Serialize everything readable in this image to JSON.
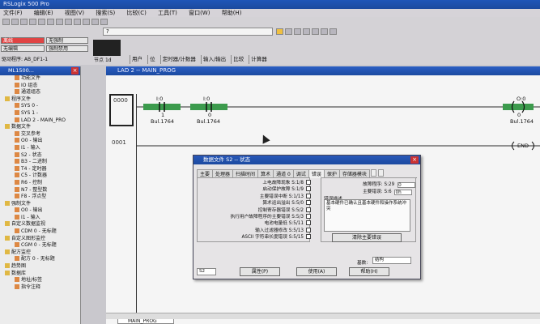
{
  "app": {
    "title": "RSLogix 500 Pro"
  },
  "menu": [
    "文件(F)",
    "编辑(E)",
    "视图(V)",
    "搜索(S)",
    "比较(C)",
    "工具(T)",
    "窗口(W)",
    "帮助(H)"
  ],
  "status": {
    "mode": "离线",
    "no_forces": "无强制",
    "no_edits": "无编辑",
    "forces_disabled": "强制禁用",
    "driver": "驱动程序: AB_DF1-1",
    "node_label": "节点",
    "node_value": "1d"
  },
  "toolbar": {
    "combo_value": "?"
  },
  "fkeys": [
    "用户",
    "位",
    "定时器/计数器",
    "输入/输出",
    "比较",
    "计算器"
  ],
  "tree": {
    "title": "ML1500...",
    "items": [
      {
        "label": "功能文件",
        "indent": 2,
        "icon": "file-icon"
      },
      {
        "label": "IO 组态",
        "indent": 2,
        "icon": "io-icon"
      },
      {
        "label": "通道组态",
        "indent": 2,
        "icon": "channel-icon"
      },
      {
        "label": "程序文件",
        "indent": 0,
        "icon": "folder-icon"
      },
      {
        "label": "SYS 0 -",
        "indent": 2,
        "icon": "file-icon"
      },
      {
        "label": "SYS 1 -",
        "indent": 2,
        "icon": "file-icon"
      },
      {
        "label": "LAD 2 - MAIN_PRO",
        "indent": 2,
        "icon": "file-icon"
      },
      {
        "label": "数据文件",
        "indent": 0,
        "icon": "folder-icon"
      },
      {
        "label": "交叉参考",
        "indent": 2,
        "icon": "xref-icon"
      },
      {
        "label": "O0 - 输出",
        "indent": 2,
        "icon": "file-icon"
      },
      {
        "label": "I1 - 输入",
        "indent": 2,
        "icon": "file-icon"
      },
      {
        "label": "S2 - 状态",
        "indent": 2,
        "icon": "file-icon"
      },
      {
        "label": "B3 - 二进制",
        "indent": 2,
        "icon": "file-icon"
      },
      {
        "label": "T4 - 定时器",
        "indent": 2,
        "icon": "file-icon"
      },
      {
        "label": "C5 - 计数器",
        "indent": 2,
        "icon": "file-icon"
      },
      {
        "label": "R6 - 控制",
        "indent": 2,
        "icon": "file-icon"
      },
      {
        "label": "N7 - 整型数",
        "indent": 2,
        "icon": "file-icon"
      },
      {
        "label": "F8 - 浮点型",
        "indent": 2,
        "icon": "file-icon"
      },
      {
        "label": "强制文件",
        "indent": 0,
        "icon": "folder-icon"
      },
      {
        "label": "O0 - 输出",
        "indent": 2,
        "icon": "file-icon"
      },
      {
        "label": "I1 - 输入",
        "indent": 2,
        "icon": "file-icon"
      },
      {
        "label": "自定义数据监视",
        "indent": 0,
        "icon": "folder-icon"
      },
      {
        "label": "CDM 0 - 无标题",
        "indent": 2,
        "icon": "file-icon"
      },
      {
        "label": "自定义图形监控",
        "indent": 0,
        "icon": "folder-icon"
      },
      {
        "label": "CGM 0 - 无标题",
        "indent": 2,
        "icon": "file-icon"
      },
      {
        "label": "配方监控",
        "indent": 0,
        "icon": "folder-icon"
      },
      {
        "label": "配方 0 - 无标题",
        "indent": 2,
        "icon": "file-icon"
      },
      {
        "label": "趋势图",
        "indent": 0,
        "icon": "folder-icon"
      },
      {
        "label": "数据库",
        "indent": 0,
        "icon": "folder-icon"
      },
      {
        "label": "地址/标签",
        "indent": 2,
        "icon": "file-icon"
      },
      {
        "label": "指令注释",
        "indent": 2,
        "icon": "file-icon"
      }
    ]
  },
  "ladder": {
    "title": "LAD 2 -- MAIN_PROG",
    "rungs": [
      {
        "number": "0000",
        "contacts": [
          {
            "addr": "I:0",
            "bit": "1",
            "tag": "Bul.1764"
          },
          {
            "addr": "I:0",
            "bit": "0",
            "tag": "Bul.1764"
          }
        ],
        "coil": {
          "addr": "O:0",
          "bit": "0",
          "tag": "Bul.1764"
        }
      },
      {
        "number": "0001",
        "end_label": "END"
      }
    ],
    "sheet_tab": "MAIN_PROG"
  },
  "dialog": {
    "title": "数据文件 S2 -- 状态",
    "tabs": [
      "主要",
      "处理器",
      "扫描时间",
      "算术",
      "通道 0",
      "调试",
      "错误",
      "保护",
      "存储器模块"
    ],
    "active_tab": "错误",
    "faults": [
      {
        "label": "上电故障现象 S:1/8",
        "checked": false
      },
      {
        "label": "启动保护故障 S:1/9",
        "checked": false
      },
      {
        "label": "主要错误中断 S:1/13",
        "checked": false
      },
      {
        "label": "算术运出溢出 S:5/0",
        "checked": false
      },
      {
        "label": "控制寄存器错误 S:5/2",
        "checked": false
      },
      {
        "label": "执行用户故障程序的主要错误 S:5/3",
        "checked": false
      },
      {
        "label": "电池电量低 S:5/11",
        "checked": false
      },
      {
        "label": "输入过滤器修改 S:5/13",
        "checked": false
      },
      {
        "label": "ASCII 字符串长度错误 S:5/15",
        "checked": false
      }
    ],
    "fault_routine_label": "故障程序:",
    "fault_routine_addr": "S:29",
    "fault_routine_value": "0",
    "major_error_label": "主要错误:",
    "major_error_addr": "S:6",
    "major_error_value": "0h",
    "error_desc_label": "错误描述",
    "error_desc_text": "基本硬件已确认且基本硬件和操作系统冲突",
    "clear_button": "清除主要错误",
    "radix_label": "基数:",
    "radix_value": "结构",
    "address_value": "S2",
    "buttons": {
      "properties": "属性(P)",
      "apply": "使用(A)",
      "help": "帮助(H)"
    }
  }
}
